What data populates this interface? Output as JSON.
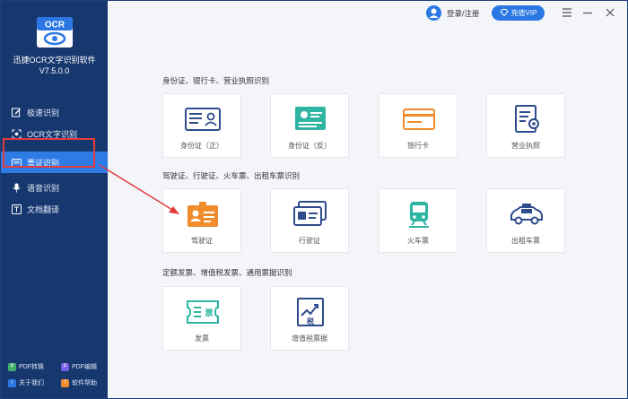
{
  "app": {
    "name": "迅捷OCR文字识别软件",
    "version": "V7.5.0.0",
    "logo_text": "OCR"
  },
  "sidebar": {
    "items": [
      {
        "label": "极速识别",
        "icon": "edit-icon"
      },
      {
        "label": "OCR文字识别",
        "icon": "ocr-icon"
      },
      {
        "label": "票证识别",
        "icon": "ticket-icon",
        "active": true
      },
      {
        "label": "语音识别",
        "icon": "microphone-icon"
      },
      {
        "label": "文档翻译",
        "icon": "translate-icon"
      }
    ],
    "bottom": [
      {
        "label": "PDF转换",
        "icon": "pdf-convert-icon"
      },
      {
        "label": "PDF编辑",
        "icon": "pdf-edit-icon"
      },
      {
        "label": "关于我们",
        "icon": "info-icon"
      },
      {
        "label": "软件帮助",
        "icon": "help-icon"
      }
    ]
  },
  "header": {
    "login_label": "登录/注册",
    "vip_label": "充值VIP"
  },
  "sections": [
    {
      "title": "身份证、银行卡、营业执照识别",
      "cards": [
        {
          "label": "身份证（正）",
          "icon": "id-card-front-icon"
        },
        {
          "label": "身份证（反）",
          "icon": "id-card-back-icon"
        },
        {
          "label": "银行卡",
          "icon": "bank-card-icon"
        },
        {
          "label": "营业执照",
          "icon": "business-license-icon"
        }
      ]
    },
    {
      "title": "驾驶证、行驶证、火车票、出租车票识别",
      "cards": [
        {
          "label": "驾驶证",
          "icon": "driver-license-icon"
        },
        {
          "label": "行驶证",
          "icon": "vehicle-license-icon"
        },
        {
          "label": "火车票",
          "icon": "train-icon"
        },
        {
          "label": "出租车票",
          "icon": "taxi-icon"
        }
      ]
    },
    {
      "title": "定额发票、增值税发票、通用票据识别",
      "cards": [
        {
          "label": "发票",
          "icon": "invoice-icon"
        },
        {
          "label": "增值税票据",
          "icon": "vat-invoice-icon"
        }
      ]
    }
  ],
  "colors": {
    "sidebar_bg": "#17386f",
    "active_bg": "#2f7be6",
    "accent": "#2b78e4",
    "highlight": "#e23c3c"
  }
}
